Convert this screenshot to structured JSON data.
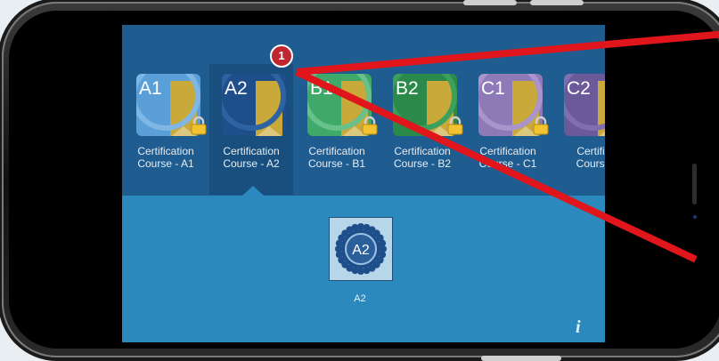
{
  "courses": [
    {
      "code": "A1",
      "line1": "Certification",
      "line2": "Course - A1",
      "color": "#5a9fd8",
      "ring": "#7fb6e4",
      "locked": true
    },
    {
      "code": "A2",
      "line1": "Certification",
      "line2": "Course - A2",
      "color": "#1f4f8a",
      "ring": "#2e63a3",
      "locked": false
    },
    {
      "code": "B1",
      "line1": "Certification",
      "line2": "Course - B1",
      "color": "#3fa96a",
      "ring": "#68c08a",
      "locked": true
    },
    {
      "code": "B2",
      "line1": "Certification",
      "line2": "Course - B2",
      "color": "#2b8a4a",
      "ring": "#3ba05c",
      "locked": true
    },
    {
      "code": "C1",
      "line1": "Certification",
      "line2": "Course - C1",
      "color": "#8f7ab8",
      "ring": "#a994cc",
      "locked": true
    },
    {
      "code": "C2",
      "line1": "Certific",
      "line2": "Course",
      "color": "#6a5a9a",
      "ring": "#7f6fb0",
      "locked": false
    }
  ],
  "notification_count": "1",
  "selected": {
    "code": "A2",
    "label": "A2"
  },
  "info_icon": "i",
  "colors": {
    "screen_bg": "#2c89bd",
    "topbar_bg": "#1f5c8f",
    "selected_bg": "#184f7e",
    "annotation": "#e0161c"
  }
}
